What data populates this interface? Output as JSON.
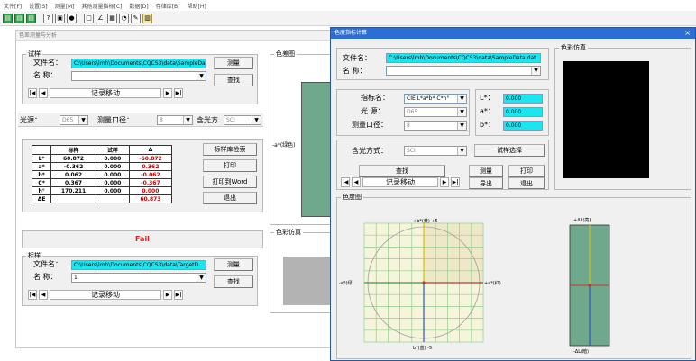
{
  "menubar": {
    "items": [
      "文件[F]",
      "设置[S]",
      "测量[M]",
      "其他测量指标[C]",
      "数据[D]",
      "存储库[B]",
      "帮助[H]"
    ]
  },
  "toolbar": {
    "icons": [
      "mode-1-icon",
      "mode-2-icon",
      "mode-3-icon",
      "help-icon",
      "instrument-icon",
      "record-icon",
      "blank-icon",
      "chart-icon",
      "report-icon",
      "pie-icon",
      "tools-icon",
      "sheet-icon"
    ]
  },
  "mainwin": {
    "title": "色差测量与分析",
    "sample": {
      "group_label": "试样",
      "file_label": "文件名：",
      "file_value": "C:\\Users\\lmh\\Documents\\CQCS3\\data\\SampleData",
      "name_label": "名  称：",
      "name_value": "",
      "measure_btn": "测量",
      "find_btn": "查找",
      "record_nav": "记录移动"
    },
    "light": {
      "light_label": "光源：",
      "light_value": "D65",
      "aperture_label": "测量口径：",
      "aperture_value": "8",
      "specular_label": "含光方",
      "specular_value": "SCI"
    },
    "table": {
      "headers": [
        "",
        "标样",
        "试样",
        "Δ"
      ],
      "rows": [
        {
          "label": "L*",
          "std": "60.872",
          "smp": "0.000",
          "delta": "-60.872",
          "red": true
        },
        {
          "label": "a*",
          "std": "-0.362",
          "smp": "0.000",
          "delta": "0.362",
          "red": true
        },
        {
          "label": "b*",
          "std": "0.062",
          "smp": "0.000",
          "delta": "-0.062",
          "red": true
        },
        {
          "label": "C*",
          "std": "0.367",
          "smp": "0.000",
          "delta": "-0.367",
          "red": true
        },
        {
          "label": "h°",
          "std": "170.211",
          "smp": "0.000",
          "delta": "0.000",
          "red": true
        },
        {
          "label": "ΔE",
          "std": "",
          "smp": "",
          "delta": "60.873",
          "red": true
        }
      ]
    },
    "side_buttons": {
      "library": "标样库检索",
      "print": "打印",
      "print_word": "打印到Word",
      "exit": "退出"
    },
    "result": "Fail",
    "standard": {
      "group_label": "标样",
      "file_label": "文件名：",
      "file_value": "C:\\Users\\lmh\\Documents\\CQCS3\\data\\TargetD",
      "name_label": "名  称：",
      "name_value": "1",
      "measure_btn": "测量",
      "find_btn": "查找",
      "record_nav": "记录移动"
    },
    "right_panels": {
      "color_diff_label": "色差图",
      "axis_a": "-a*(绿色)",
      "color_sim_label": "色彩仿真"
    }
  },
  "dialog": {
    "title": "色度指标计算",
    "close": "×",
    "file_label": "文件名：",
    "file_value": "C:\\Users\\lmh\\Documents\\CQCS3\\data\\SampleData.dat",
    "name_label": "名  称：",
    "index_label": "指标名：",
    "index_value": "CIE L*a*b* C*h°",
    "light_label": "光  源：",
    "light_value": "D65",
    "aperture_label": "测量口径：",
    "aperture_value": "8",
    "L_label": "L*：",
    "L_value": "0.000",
    "a_label": "a*：",
    "a_value": "0.000",
    "b_label": "b*：",
    "b_value": "0.000",
    "specular_label": "含光方式：",
    "specular_value": "SCI",
    "sample_select_btn": "试样选择",
    "find_btn": "查找",
    "measure_btn": "测量",
    "print_btn": "打印",
    "export_btn": "导出",
    "exit_btn": "退出",
    "record_nav": "记录移动",
    "color_sim_label": "色彩仿真",
    "color_diff_label": "色度图",
    "axis_b_pos": "+b*(黄)  +5",
    "axis_b_neg": "b*(蓝)  -5",
    "axis_a_neg": "-a*(绿)",
    "axis_a_pos": "+a*(红)",
    "axis_L_pos": "+ΔL(亮)",
    "axis_L_neg": "-ΔL(暗)"
  },
  "colors": {
    "swatch_green": "#6fa88c",
    "swatch_grey": "#b3b3b3",
    "title_blue": "#2b6fd6",
    "cyan_field": "#19e6f0",
    "fail_red": "#e02020"
  }
}
